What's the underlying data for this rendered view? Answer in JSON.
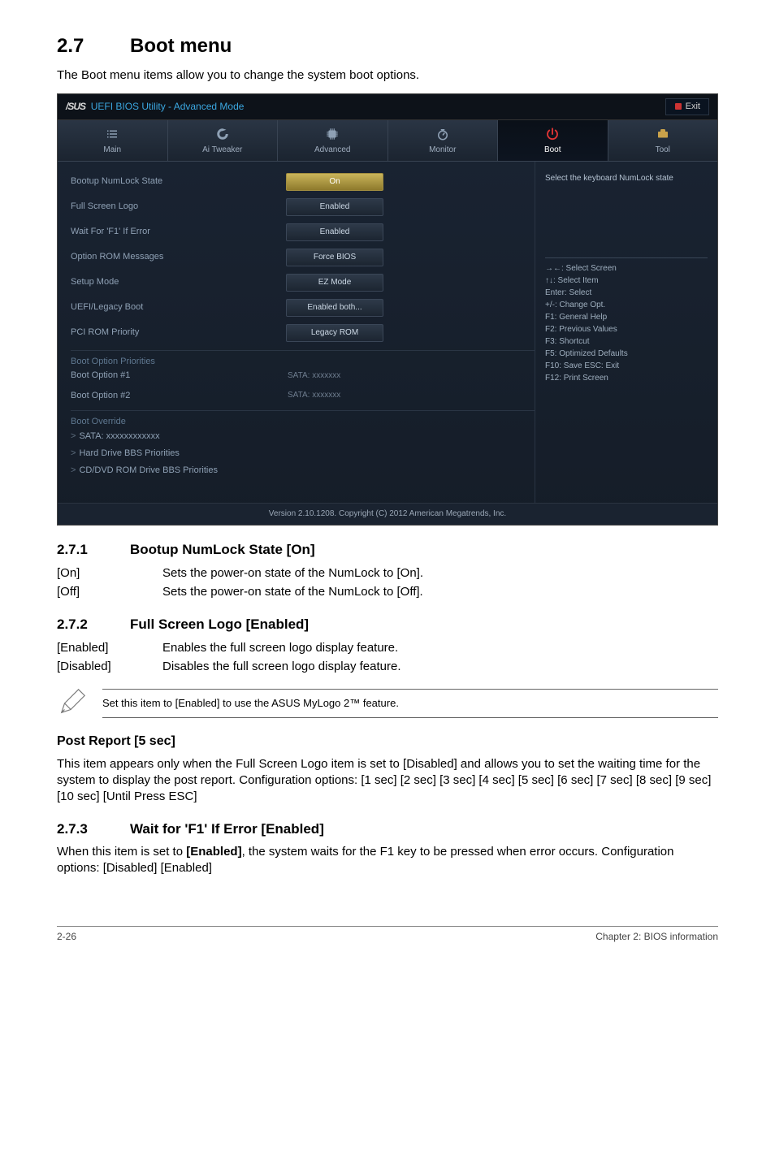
{
  "doc": {
    "section_num": "2.7",
    "section_title": "Boot menu",
    "intro": "The Boot menu items allow you to change the system boot options.",
    "sub1_num": "2.7.1",
    "sub1_title": "Bootup NumLock State [On]",
    "sub1_on_key": "[On]",
    "sub1_on_desc": "Sets the power-on state of the NumLock to [On].",
    "sub1_off_key": "[Off]",
    "sub1_off_desc": "Sets the power-on state of the NumLock to [Off].",
    "sub2_num": "2.7.2",
    "sub2_title": "Full Screen Logo [Enabled]",
    "sub2_en_key": "[Enabled]",
    "sub2_en_desc": "Enables the full screen logo display feature.",
    "sub2_dis_key": "[Disabled]",
    "sub2_dis_desc": "Disables the full screen logo display feature.",
    "note": "Set this item to [Enabled] to use the ASUS MyLogo 2™ feature.",
    "post_title": "Post Report [5 sec]",
    "post_body": "This item appears only when the Full Screen Logo item is set to [Disabled] and allows you to set the waiting time for the system to display the post report. Configuration options: [1 sec] [2 sec] [3 sec] [4 sec] [5 sec] [6 sec] [7 sec] [8 sec] [9 sec] [10 sec] [Until Press ESC]",
    "sub3_num": "2.7.3",
    "sub3_title": "Wait for 'F1' If Error [Enabled]",
    "sub3_body_pre": "When this item is set to ",
    "sub3_body_bold": "[Enabled]",
    "sub3_body_post": ", the system waits for the F1 key to be pressed when error occurs. Configuration options: [Disabled] [Enabled]",
    "footer_left": "2-26",
    "footer_right": "Chapter 2: BIOS information"
  },
  "bios": {
    "brand": "/SUS",
    "title": "UEFI BIOS Utility - Advanced Mode",
    "exit": "Exit",
    "tabs": {
      "main": "Main",
      "ai": "Ai  Tweaker",
      "advanced": "Advanced",
      "monitor": "Monitor",
      "boot": "Boot",
      "tool": "Tool"
    },
    "rows": {
      "numlock": {
        "label": "Bootup NumLock State",
        "value": "On"
      },
      "logo": {
        "label": "Full Screen Logo",
        "value": "Enabled"
      },
      "waitf1": {
        "label": "Wait For 'F1' If Error",
        "value": "Enabled"
      },
      "optrom": {
        "label": "Option ROM Messages",
        "value": "Force BIOS"
      },
      "setup": {
        "label": "Setup Mode",
        "value": "EZ Mode"
      },
      "uefi": {
        "label": "UEFI/Legacy Boot",
        "value": "Enabled both..."
      },
      "pci": {
        "label": "PCI ROM Priority",
        "value": "Legacy ROM"
      }
    },
    "groups": {
      "boot_priorities": "Boot Option Priorities",
      "boot1_label": "Boot Option #1",
      "boot1_value": "SATA: xxxxxxx",
      "boot2_label": "Boot Option #2",
      "boot2_value": "SATA: xxxxxxx",
      "override": "Boot Override",
      "sata": "SATA: xxxxxxxxxxxx",
      "hdd": "Hard Drive BBS Priorities",
      "cd": "CD/DVD ROM Drive BBS Priorities"
    },
    "help": {
      "title": "Select the keyboard NumLock state",
      "k1": "→←:  Select Screen",
      "k2": "↑↓:  Select Item",
      "k3": "Enter:  Select",
      "k4": "+/-:  Change Opt.",
      "k5": "F1:  General Help",
      "k6": "F2:  Previous Values",
      "k7": "F3:  Shortcut",
      "k8": "F5:  Optimized Defaults",
      "k9": "F10:  Save   ESC:  Exit",
      "k10": "F12:  Print Screen"
    },
    "footer": "Version  2.10.1208.   Copyright  (C)  2012 American  Megatrends,  Inc."
  }
}
